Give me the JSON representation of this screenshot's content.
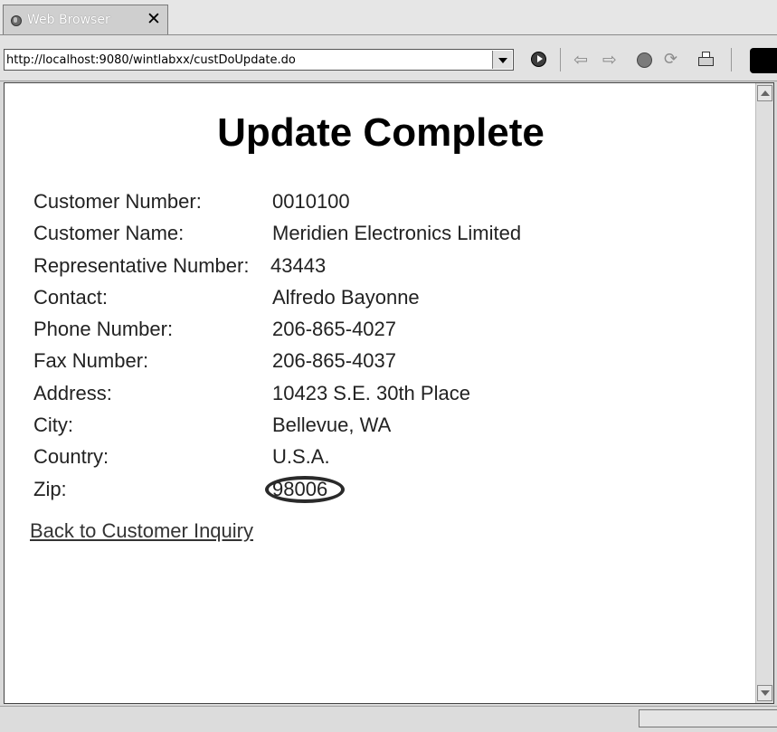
{
  "tab": {
    "title": "Web Browser",
    "close_glyph": "✕"
  },
  "toolbar": {
    "url": "http://localhost:9080/wintlabxx/custDoUpdate.do",
    "icons": [
      "dropdown-icon",
      "go-icon",
      "back-icon",
      "forward-icon",
      "stop-icon",
      "refresh-icon",
      "print-icon"
    ]
  },
  "page": {
    "title": "Update Complete",
    "fields": [
      {
        "label": "Customer Number:",
        "value": "0010100"
      },
      {
        "label": "Customer Name:",
        "value": "Meridien Electronics Limited"
      },
      {
        "label": "Representative Number:",
        "value": "43443"
      },
      {
        "label": "Contact:",
        "value": "Alfredo Bayonne"
      },
      {
        "label": "Phone Number:",
        "value": "206-865-4027"
      },
      {
        "label": "Fax Number:",
        "value": "206-865-4037"
      },
      {
        "label": "Address:",
        "value": "10423 S.E. 30th Place"
      },
      {
        "label": "City:",
        "value": "Bellevue, WA"
      },
      {
        "label": "Country:",
        "value": "U.S.A."
      },
      {
        "label": "Zip:",
        "value": "98006",
        "highlighted": true
      }
    ],
    "back_link": "Back to Customer Inquiry"
  }
}
